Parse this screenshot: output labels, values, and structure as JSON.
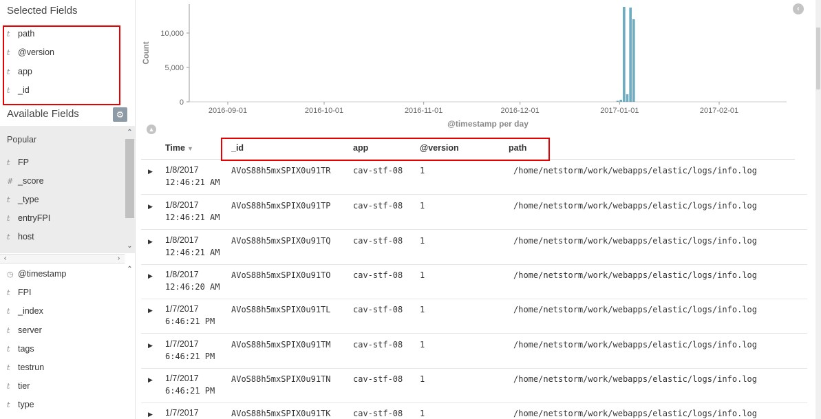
{
  "sidebar": {
    "selected_title": "Selected Fields",
    "selected_fields": [
      {
        "icon": "t",
        "name": "path"
      },
      {
        "icon": "t",
        "name": "@version"
      },
      {
        "icon": "t",
        "name": "app"
      },
      {
        "icon": "t",
        "name": "_id"
      }
    ],
    "available_title": "Available Fields",
    "popular_label": "Popular",
    "popular_fields": [
      {
        "icon": "t",
        "name": "FP"
      },
      {
        "icon": "#",
        "name": "_score"
      },
      {
        "icon": "t",
        "name": "_type"
      },
      {
        "icon": "t",
        "name": "entryFPI"
      },
      {
        "icon": "t",
        "name": "host"
      }
    ],
    "other_fields": [
      {
        "icon": "clock",
        "name": "@timestamp"
      },
      {
        "icon": "t",
        "name": "FPI"
      },
      {
        "icon": "t",
        "name": "_index"
      },
      {
        "icon": "t",
        "name": "server"
      },
      {
        "icon": "t",
        "name": "tags"
      },
      {
        "icon": "t",
        "name": "testrun"
      },
      {
        "icon": "t",
        "name": "tier"
      },
      {
        "icon": "t",
        "name": "type"
      }
    ]
  },
  "chart_data": {
    "type": "bar",
    "xlabel": "@timestamp per day",
    "ylabel": "Count",
    "yticks": [
      0,
      5000,
      10000
    ],
    "ytick_labels": [
      "0",
      "5,000",
      "10,000"
    ],
    "ylim": [
      0,
      14200
    ],
    "xlim": [
      "2016-08-20",
      "2017-02-22"
    ],
    "xtick_labels": [
      "2016-09-01",
      "2016-10-01",
      "2016-11-01",
      "2016-12-01",
      "2017-01-01",
      "2017-02-01"
    ],
    "xtick_dates": [
      "2016-09-01",
      "2016-10-01",
      "2016-11-01",
      "2016-12-01",
      "2017-01-01",
      "2017-02-01"
    ],
    "grid": false,
    "bar_color": "#6eadc1",
    "x": [
      "2016-12-31",
      "2017-01-01",
      "2017-01-02",
      "2017-01-03",
      "2017-01-04",
      "2017-01-05",
      "2017-01-06",
      "2017-01-07",
      "2017-01-08"
    ],
    "values": [
      150,
      300,
      13800,
      1100,
      13700,
      12000,
      0,
      0,
      0
    ]
  },
  "table": {
    "headers": {
      "time": "Time",
      "id": "_id",
      "app": "app",
      "version": "@version",
      "path": "path"
    },
    "rows": [
      {
        "date": "1/8/2017",
        "time": "12:46:21 AM",
        "id": "AVoS88h5mxSPIX0u91TR",
        "app": "cav-stf-08",
        "version": "1",
        "path": "/home/netstorm/work/webapps/elastic/logs/info.log"
      },
      {
        "date": "1/8/2017",
        "time": "12:46:21 AM",
        "id": "AVoS88h5mxSPIX0u91TP",
        "app": "cav-stf-08",
        "version": "1",
        "path": "/home/netstorm/work/webapps/elastic/logs/info.log"
      },
      {
        "date": "1/8/2017",
        "time": "12:46:21 AM",
        "id": "AVoS88h5mxSPIX0u91TQ",
        "app": "cav-stf-08",
        "version": "1",
        "path": "/home/netstorm/work/webapps/elastic/logs/info.log"
      },
      {
        "date": "1/8/2017",
        "time": "12:46:20 AM",
        "id": "AVoS88h5mxSPIX0u91TO",
        "app": "cav-stf-08",
        "version": "1",
        "path": "/home/netstorm/work/webapps/elastic/logs/info.log"
      },
      {
        "date": "1/7/2017",
        "time": "6:46:21 PM",
        "id": "AVoS88h5mxSPIX0u91TL",
        "app": "cav-stf-08",
        "version": "1",
        "path": "/home/netstorm/work/webapps/elastic/logs/info.log"
      },
      {
        "date": "1/7/2017",
        "time": "6:46:21 PM",
        "id": "AVoS88h5mxSPIX0u91TM",
        "app": "cav-stf-08",
        "version": "1",
        "path": "/home/netstorm/work/webapps/elastic/logs/info.log"
      },
      {
        "date": "1/7/2017",
        "time": "6:46:21 PM",
        "id": "AVoS88h5mxSPIX0u91TN",
        "app": "cav-stf-08",
        "version": "1",
        "path": "/home/netstorm/work/webapps/elastic/logs/info.log"
      },
      {
        "date": "1/7/2017",
        "time": "",
        "id": "AVoS88h5mxSPIX0u91TK",
        "app": "cav-stf-08",
        "version": "1",
        "path": "/home/netstorm/work/webapps/elastic/logs/info.log"
      }
    ]
  },
  "colors": {
    "highlight_box": "#e60000",
    "bar": "#6eadc1",
    "gear_button": "#8c9ba5"
  },
  "icons": {
    "gear": "gear-icon",
    "collapse_right": "chevron-left-icon",
    "collapse_up": "chevron-up-icon",
    "expand_row": "caret-right-icon",
    "sort": "sort-down-icon"
  }
}
